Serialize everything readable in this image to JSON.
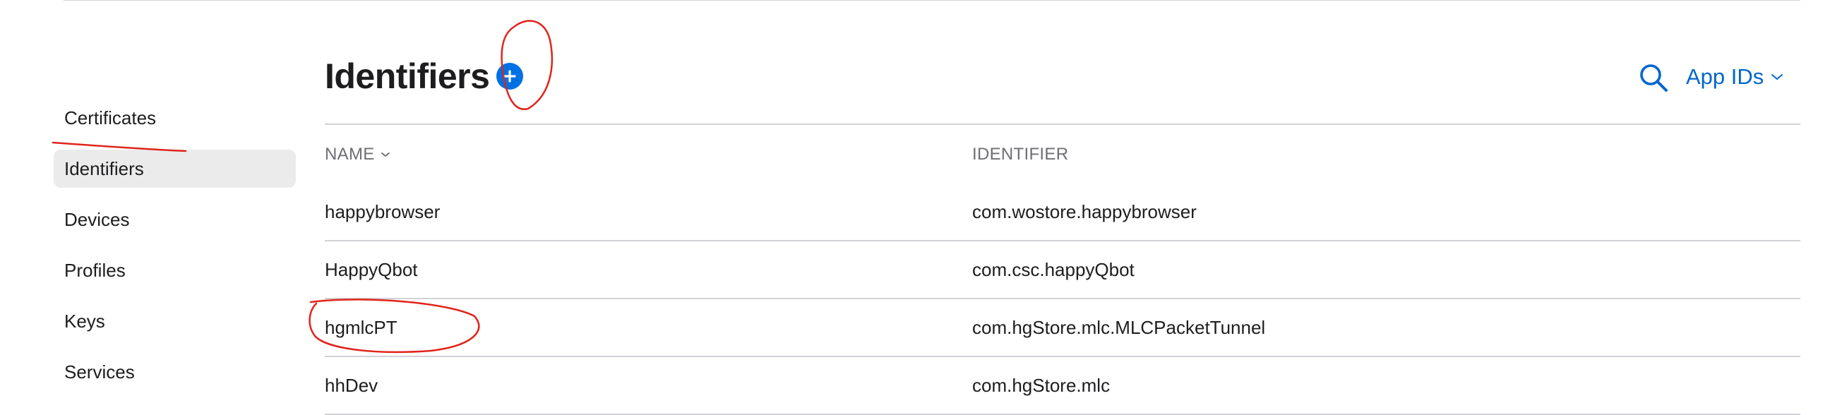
{
  "sidebar": {
    "items": [
      {
        "label": "Certificates"
      },
      {
        "label": "Identifiers",
        "active": true
      },
      {
        "label": "Devices"
      },
      {
        "label": "Profiles"
      },
      {
        "label": "Keys"
      },
      {
        "label": "Services"
      }
    ]
  },
  "header": {
    "title": "Identifiers",
    "add_icon": "plus-circle-icon",
    "search_icon": "search-icon",
    "filter_label": "App IDs",
    "filter_icon": "chevron-down-icon"
  },
  "table": {
    "columns": [
      "NAME",
      "IDENTIFIER"
    ],
    "sort_icon": "chevron-down-icon",
    "rows": [
      {
        "name": "happybrowser",
        "identifier": "com.wostore.happybrowser"
      },
      {
        "name": "HappyQbot",
        "identifier": "com.csc.happyQbot"
      },
      {
        "name": "hgmlcPT",
        "identifier": "com.hgStore.mlc.MLCPacketTunnel"
      },
      {
        "name": "hhDev",
        "identifier": "com.hgStore.mlc"
      }
    ]
  },
  "colors": {
    "accent": "#0066cc",
    "add_button": "#0071e3",
    "active_nav_bg": "#ebebeb",
    "annotation": "#e0241b"
  }
}
